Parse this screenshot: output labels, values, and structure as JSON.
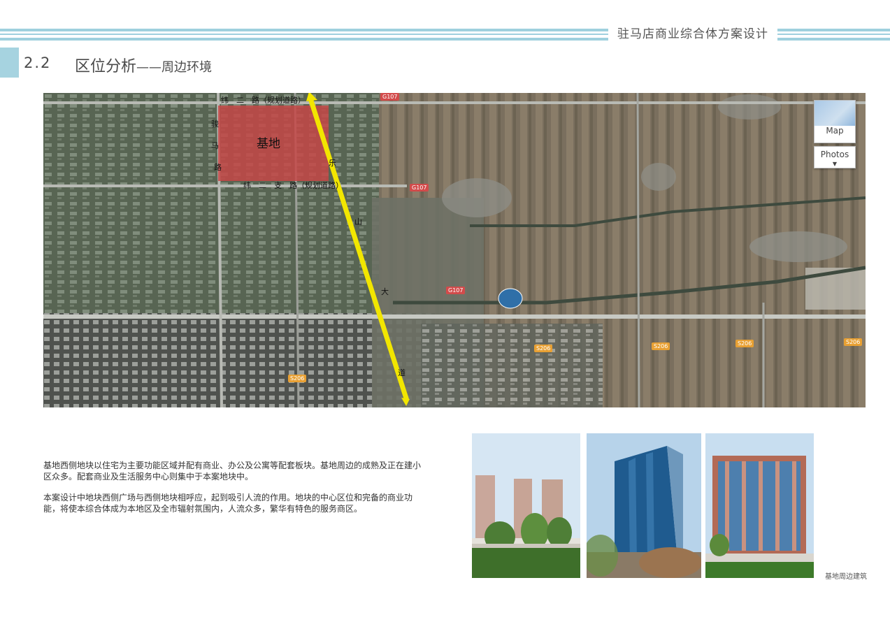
{
  "header": {
    "project_title": "驻马店商业综合体方案设计"
  },
  "section": {
    "number": "2.2",
    "title": "区位分析",
    "subtitle": "——周边环境"
  },
  "map": {
    "site_label": "基地",
    "road_top": "纬　二　路（规划道路）",
    "road_bottom": "纬　二　支　路（规划道路）",
    "road_west": [
      "骏",
      "马",
      "路"
    ],
    "road_east": [
      "乐",
      "山",
      "大",
      "道"
    ],
    "route_tags": [
      "G107",
      "G107",
      "G107",
      "S206",
      "S206",
      "S206",
      "S206",
      "S206"
    ],
    "controls": {
      "map_label": "Map",
      "photos_label": "Photos"
    }
  },
  "description": {
    "paragraphs": [
      "基地西侧地块以住宅为主要功能区域并配有商业、办公及公寓等配套板块。基地周边的成熟及正在建小区众多。配套商业及生活服务中心则集中于本案地块中。",
      "本案设计中地块西侧广场与西侧地块相呼应，起到吸引人流的作用。地块的中心区位和完备的商业功能，将使本综合体成为本地区及全市辐射氛围内，人流众多，繁华有特色的服务商区。"
    ]
  },
  "photos": {
    "caption": "基地周边建筑"
  },
  "colors": {
    "accent_band": "#9fd0de",
    "site_red": "#c84646",
    "road_yellow": "#f2e600"
  }
}
